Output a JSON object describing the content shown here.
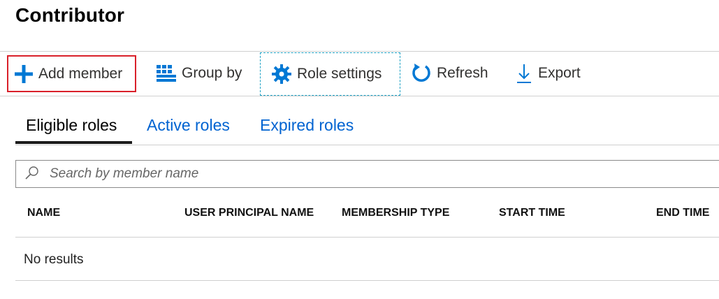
{
  "page": {
    "title": "Contributor"
  },
  "toolbar": {
    "add_member": {
      "label": "Add member",
      "icon": "plus-icon"
    },
    "group_by": {
      "label": "Group by",
      "icon": "grid-icon"
    },
    "role_settings": {
      "label": "Role settings",
      "icon": "gear-icon"
    },
    "refresh": {
      "label": "Refresh",
      "icon": "refresh-icon"
    },
    "export": {
      "label": "Export",
      "icon": "download-icon"
    }
  },
  "tabs": [
    {
      "label": "Eligible roles",
      "selected": true
    },
    {
      "label": "Active roles",
      "selected": false
    },
    {
      "label": "Expired roles",
      "selected": false
    }
  ],
  "search": {
    "placeholder": "Search by member name",
    "value": ""
  },
  "table": {
    "columns": [
      "NAME",
      "USER PRINCIPAL NAME",
      "MEMBERSHIP TYPE",
      "START TIME",
      "END TIME"
    ],
    "empty_message": "No results"
  },
  "colors": {
    "accent": "#0078d4",
    "link": "#0063d1",
    "highlight_border": "#d9202a"
  }
}
